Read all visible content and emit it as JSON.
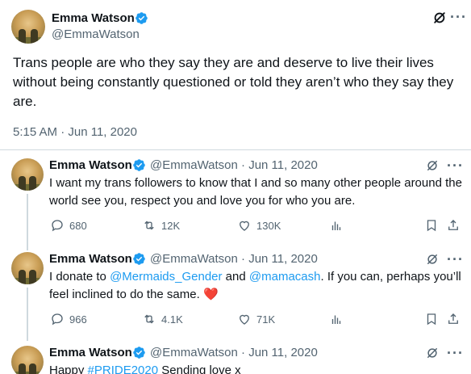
{
  "main_tweet": {
    "author_name": "Emma Watson",
    "author_handle": "@EmmaWatson",
    "text": "Trans people are who they say they are and deserve to live their lives without being constantly questioned or told they aren’t who they say they are.",
    "timestamp": "5:15 AM · Jun 11, 2020"
  },
  "thread": [
    {
      "author_name": "Emma Watson",
      "meta": "@EmmaWatson · Jun 11, 2020",
      "text": "I want my trans followers to know that I and so many other people around the world see you, respect you and love you for who you are.",
      "replies": "680",
      "retweets": "12K",
      "likes": "130K"
    },
    {
      "author_name": "Emma Watson",
      "meta": "@EmmaWatson · Jun 11, 2020",
      "text_before": "I donate to ",
      "mention1": "@Mermaids_Gender",
      "text_mid": " and ",
      "mention2": "@mamacash",
      "text_after": ". If you can, perhaps you’ll feel inclined to do the same. ",
      "emoji": "❤️",
      "replies": "966",
      "retweets": "4.1K",
      "likes": "71K"
    },
    {
      "author_name": "Emma Watson",
      "meta": "@EmmaWatson · Jun 11, 2020",
      "text_before": "Happy ",
      "hashtag": "#PRIDE2020",
      "text_after": " Sending love x"
    }
  ],
  "colors": {
    "verified": "#1d9bf0",
    "link": "#1d9bf0",
    "secondary": "#536471",
    "divider": "#cfd9de"
  }
}
